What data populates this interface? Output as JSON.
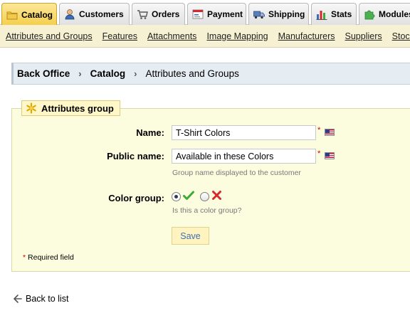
{
  "tabs": [
    {
      "label": "Catalog",
      "icon": "folder-icon",
      "active": true
    },
    {
      "label": "Customers",
      "icon": "customer-icon",
      "active": false
    },
    {
      "label": "Orders",
      "icon": "cart-icon",
      "active": false
    },
    {
      "label": "Payment",
      "icon": "payment-icon",
      "active": false
    },
    {
      "label": "Shipping",
      "icon": "truck-icon",
      "active": false
    },
    {
      "label": "Stats",
      "icon": "bar-chart-icon",
      "active": false
    },
    {
      "label": "Modules",
      "icon": "puzzle-icon",
      "active": false
    }
  ],
  "subnav": [
    "Attributes and Groups",
    "Features",
    "Attachments",
    "Image Mapping",
    "Manufacturers",
    "Suppliers",
    "Stock"
  ],
  "breadcrumb": {
    "items": [
      "Back Office",
      "Catalog",
      "Attributes and Groups"
    ],
    "separator": "›"
  },
  "form": {
    "legend": "Attributes group",
    "name_label": "Name:",
    "name_value": "T-Shirt Colors",
    "public_label": "Public name:",
    "public_value": "Available in these Colors",
    "public_hint": "Group name displayed to the customer",
    "color_label": "Color group:",
    "color_hint": "Is this a color group?",
    "color_group_yes_selected": true,
    "required_mark": "*",
    "save_label": "Save",
    "required_note": "Required field"
  },
  "back_link": "Back to list",
  "colors": {
    "active_tab": "#f5cf4a",
    "subnav_bg": "#f6f1d3",
    "breadcrumb_bg": "#e5ecf2",
    "fieldset_bg": "#fcfcdf",
    "required": "#cc0000",
    "check": "#3fa836",
    "cross": "#d9262c"
  }
}
